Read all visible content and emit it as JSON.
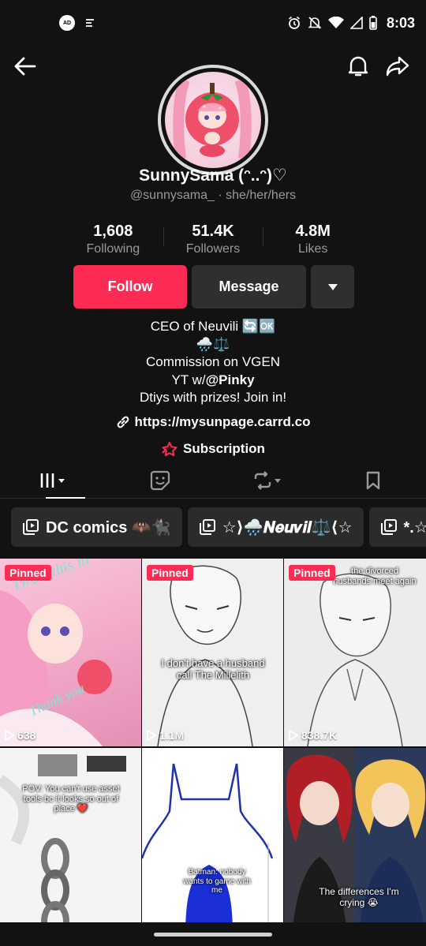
{
  "status_bar": {
    "badge_text": "AD BLOCKER",
    "time": "8:03"
  },
  "profile": {
    "display_name": "SunnySama (ᵔ..ᵔ)♡",
    "handle_line": "@sunnysama_ · she/her/hers"
  },
  "stats": [
    {
      "value": "1,608",
      "label": "Following"
    },
    {
      "value": "51.4K",
      "label": "Followers"
    },
    {
      "value": "4.8M",
      "label": "Likes"
    }
  ],
  "actions": {
    "follow": "Follow",
    "message": "Message"
  },
  "bio": {
    "line1": "CEO of Neuvili 🔄🆗",
    "line2": "🌧️⚖️",
    "line3": "Commission on VGEN",
    "line4_prefix": "YT w/",
    "line4_mention": "@Pinky",
    "line5": "Dtiys with prizes! Join in!"
  },
  "link": "https://mysunpage.carrd.co",
  "subscription": "Subscription",
  "playlists": [
    {
      "label": "DC comics 🦇🐈‍⬛"
    },
    {
      "label": "☆⟩🌧️𝑵𝒆𝒖𝒗𝒊𝒍⚖️⟨☆"
    },
    {
      "label": "*.☆.*M"
    }
  ],
  "videos": [
    {
      "pinned": "Pinned",
      "views": "638",
      "caption": "",
      "bg": "#f1b8d0"
    },
    {
      "pinned": "Pinned",
      "views": "1.1M",
      "caption": "I don't have a husband call The Millelith",
      "bg": "#efefef"
    },
    {
      "pinned": "Pinned",
      "views": "838.7K",
      "caption": "the divorced husbands meet again",
      "bg": "#ececec"
    },
    {
      "pinned": "",
      "views": "",
      "caption": "POV: You can't use asset tools bc it looks so out of place ❤️",
      "bg": "#f4f4f4"
    },
    {
      "pinned": "",
      "views": "",
      "caption": "Batman: nobody wants to game with me",
      "bg": "#ffffff"
    },
    {
      "pinned": "",
      "views": "",
      "caption": "The differences I'm crying 😭",
      "bg": "#2b3346"
    }
  ]
}
